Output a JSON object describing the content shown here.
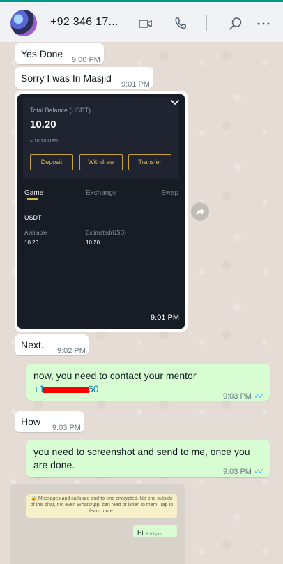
{
  "header": {
    "contact_name": "+92 346 17...",
    "video_icon": "video-call-icon",
    "call_icon": "phone-icon",
    "search_icon": "search-icon",
    "menu_icon": "more-options-icon"
  },
  "messages": [
    {
      "text": "Yes Done",
      "time": "9:00 PM"
    },
    {
      "text": "Sorry I was In Masjid",
      "time": "9:01 PM"
    },
    {
      "time": "9:01 PM"
    },
    {
      "text": "Next..",
      "time": "9:02 PM"
    },
    {
      "text": "now, you need to contact your mentor",
      "link_prefix": "+1",
      "link_suffix": "60",
      "time": "9:03 PM"
    },
    {
      "text": "How",
      "time": "9:03 PM"
    },
    {
      "text": "you need to screenshot and send to me, once you are done.",
      "time": "9:03 PM"
    }
  ],
  "screenshot": {
    "balance_label": "Total Balance (USDT)",
    "balance_value": "10.20",
    "balance_usd": "≈ 10.20 USD",
    "buttons": [
      "Deposit",
      "Withdraw",
      "Transfer"
    ],
    "tabs": [
      "Game",
      "Exchange",
      "Swap"
    ],
    "asset": "USDT",
    "available_label": "Available",
    "available_value": "10.20",
    "estimated_label": "Estimated(USD)",
    "estimated_value": "10.20"
  },
  "bottom_shot": {
    "encryption_notice": "🔒 Messages and calls are end-to-end encrypted. No one outside of this chat, not even WhatsApp, can read or listen to them. Tap to learn more.",
    "msg_text": "Hi",
    "msg_time": "6:03 pm"
  }
}
